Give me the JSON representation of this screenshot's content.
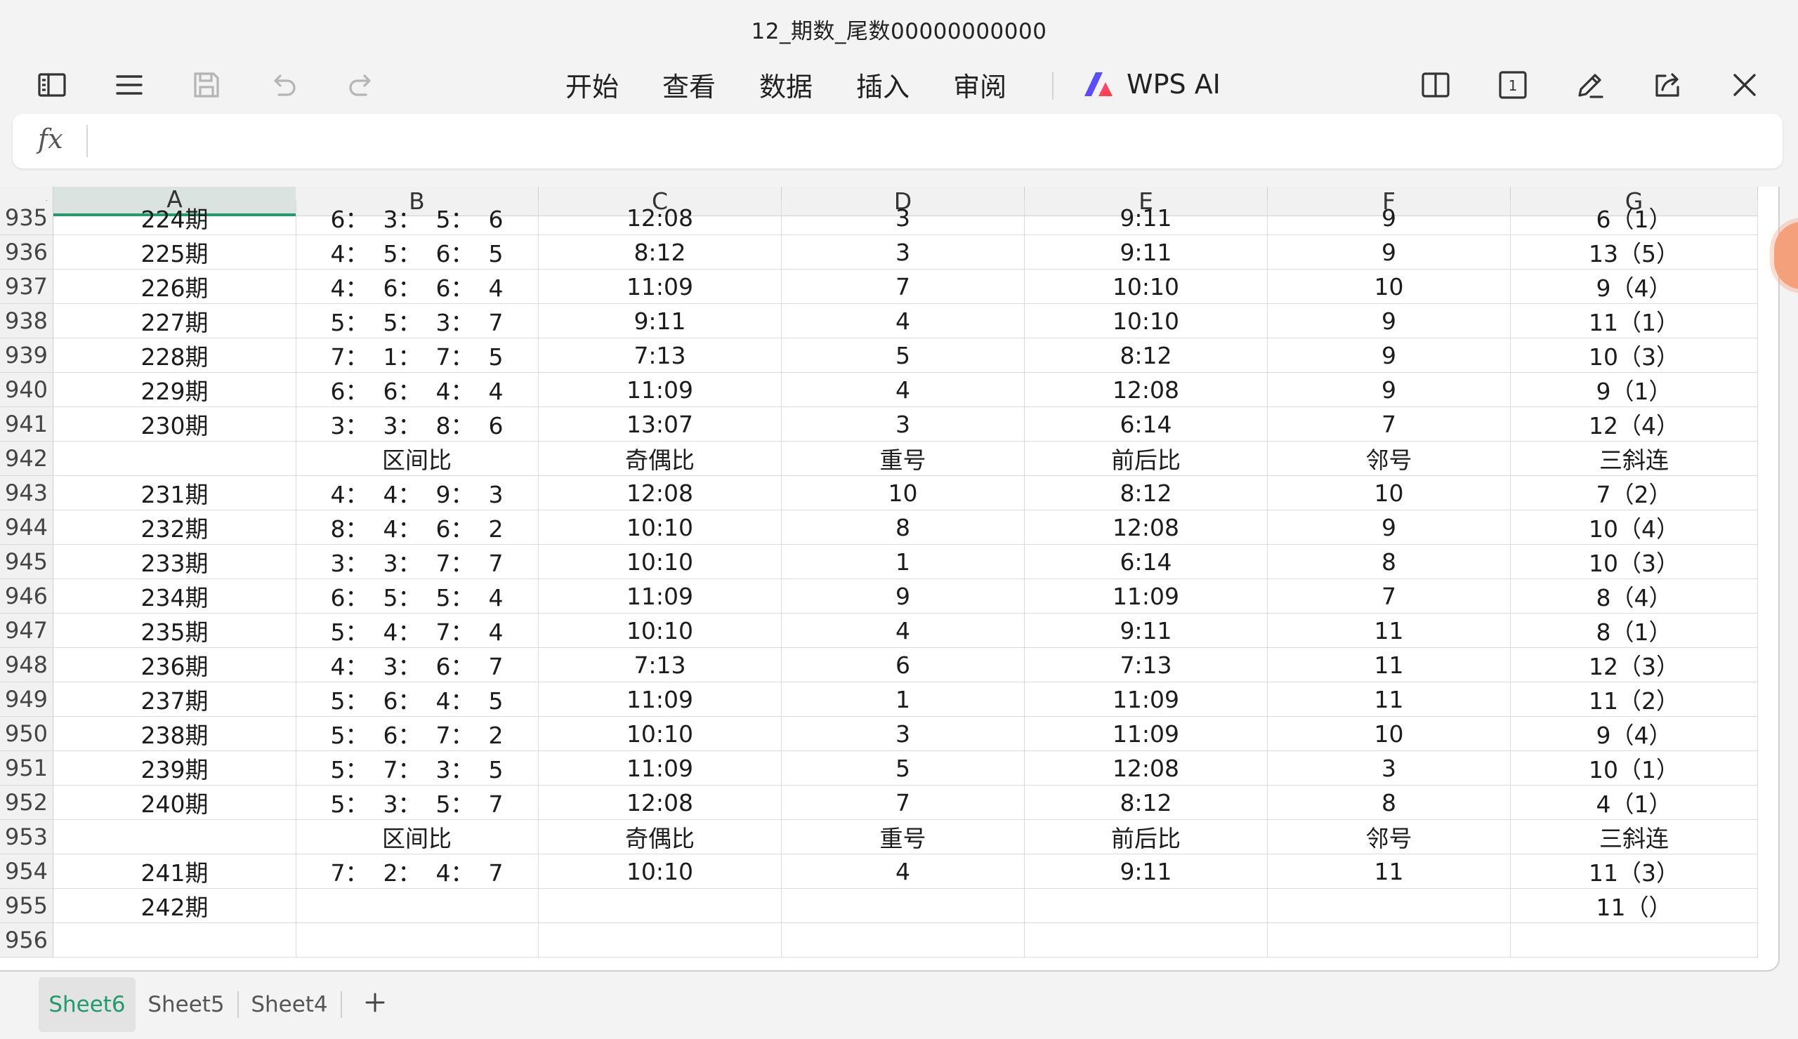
{
  "window": {
    "title": "12_期数_尾数00000000000"
  },
  "toolbar": {
    "menu": [
      "开始",
      "查看",
      "数据",
      "插入",
      "审阅"
    ],
    "ai_label": "WPS AI",
    "page_indicator": "1"
  },
  "formula": {
    "label": "fx",
    "value": ""
  },
  "columns": [
    "A",
    "B",
    "C",
    "D",
    "E",
    "F",
    "G"
  ],
  "rows": [
    {
      "num": "935",
      "cells": [
        "224期",
        "6：  3：  5：  6",
        "12:08",
        "3",
        "9:11",
        "9",
        "6（1）"
      ]
    },
    {
      "num": "936",
      "cells": [
        "225期",
        "4：  5：  6：  5",
        "8:12",
        "3",
        "9:11",
        "9",
        "13（5）"
      ]
    },
    {
      "num": "937",
      "cells": [
        "226期",
        "4：  6：  6：  4",
        "11:09",
        "7",
        "10:10",
        "10",
        "9（4）"
      ]
    },
    {
      "num": "938",
      "cells": [
        "227期",
        "5：  5：  3：  7",
        "9:11",
        "4",
        "10:10",
        "9",
        "11（1）"
      ]
    },
    {
      "num": "939",
      "cells": [
        "228期",
        "7：  1：  7：  5",
        "7:13",
        "5",
        "8:12",
        "9",
        "10（3）"
      ]
    },
    {
      "num": "940",
      "cells": [
        "229期",
        "6：  6：  4：  4",
        "11:09",
        "4",
        "12:08",
        "9",
        "9（1）"
      ]
    },
    {
      "num": "941",
      "cells": [
        "230期",
        "3：  3：  8：  6",
        "13:07",
        "3",
        "6:14",
        "7",
        "12（4）"
      ]
    },
    {
      "num": "942",
      "cells": [
        "",
        "区间比",
        "奇偶比",
        "重号",
        "前后比",
        "邻号",
        "三斜连"
      ]
    },
    {
      "num": "943",
      "cells": [
        "231期",
        "4：  4：  9：  3",
        "12:08",
        "10",
        "8:12",
        "10",
        "7（2）"
      ]
    },
    {
      "num": "944",
      "cells": [
        "232期",
        "8：  4：  6：  2",
        "10:10",
        "8",
        "12:08",
        "9",
        "10（4）"
      ]
    },
    {
      "num": "945",
      "cells": [
        "233期",
        "3：  3：  7：  7",
        "10:10",
        "1",
        "6:14",
        "8",
        "10（3）"
      ]
    },
    {
      "num": "946",
      "cells": [
        "234期",
        "6：  5：  5：  4",
        "11:09",
        "9",
        "11:09",
        "7",
        "8（4）"
      ]
    },
    {
      "num": "947",
      "cells": [
        "235期",
        "5：  4：  7：  4",
        "10:10",
        "4",
        "9:11",
        "11",
        "8（1）"
      ]
    },
    {
      "num": "948",
      "cells": [
        "236期",
        "4：  3：  6：  7",
        "7:13",
        "6",
        "7:13",
        "11",
        "12（3）"
      ]
    },
    {
      "num": "949",
      "cells": [
        "237期",
        "5：  6：  4：  5",
        "11:09",
        "1",
        "11:09",
        "11",
        "11（2）"
      ]
    },
    {
      "num": "950",
      "cells": [
        "238期",
        "5：  6：  7：  2",
        "10:10",
        "3",
        "11:09",
        "10",
        "9（4）"
      ]
    },
    {
      "num": "951",
      "cells": [
        "239期",
        "5：  7：  3：  5",
        "11:09",
        "5",
        "12:08",
        "3",
        "10（1）"
      ]
    },
    {
      "num": "952",
      "cells": [
        "240期",
        "5：  3：  5：  7",
        "12:08",
        "7",
        "8:12",
        "8",
        "4（1）"
      ]
    },
    {
      "num": "953",
      "cells": [
        "",
        "区间比",
        "奇偶比",
        "重号",
        "前后比",
        "邻号",
        "三斜连"
      ]
    },
    {
      "num": "954",
      "cells": [
        "241期",
        "7：  2：  4：  7",
        "10:10",
        "4",
        "9:11",
        "11",
        "11（3）"
      ]
    },
    {
      "num": "955",
      "cells": [
        "242期",
        "",
        "",
        "",
        "",
        "",
        "11（）"
      ]
    },
    {
      "num": "956",
      "cells": [
        "",
        "",
        "",
        "",
        "",
        "",
        ""
      ]
    }
  ],
  "sheets": [
    {
      "label": "Sheet6",
      "active": true
    },
    {
      "label": "Sheet5",
      "active": false
    },
    {
      "label": "Sheet4",
      "active": false
    }
  ],
  "colors": {
    "accent": "#1f9b6c",
    "selected_header": "#dbe3e1"
  },
  "icons": {
    "left": [
      "sidebar-toggle-icon",
      "menu-icon",
      "save-icon",
      "undo-icon",
      "redo-icon"
    ],
    "right": [
      "split-view-icon",
      "page-indicator-icon",
      "edit-pen-icon",
      "share-icon",
      "close-icon"
    ],
    "ai": "wps-ai-logo-icon",
    "add_sheet": "plus-icon"
  }
}
